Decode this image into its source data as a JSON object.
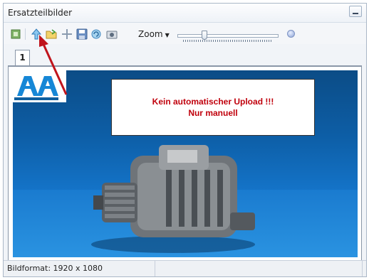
{
  "window": {
    "title": "Ersatzteilbilder"
  },
  "toolbar": {
    "icons": [
      "insert-image-icon",
      "upload-arrow-icon",
      "open-folder-icon",
      "crosshair-icon",
      "save-icon",
      "refresh-image-icon",
      "camera-icon"
    ],
    "zoom_label": "Zoom",
    "zoom_level_fraction": 0.25
  },
  "tabs": [
    {
      "label": "1"
    }
  ],
  "image": {
    "notice_line1": "Kein automatischer Upload !!!",
    "notice_line2": "Nur manuell",
    "notice_color": "#c0000c"
  },
  "status": {
    "format": "Bildformat: 1920 x 1080"
  },
  "annotation_color": "#c0141c"
}
